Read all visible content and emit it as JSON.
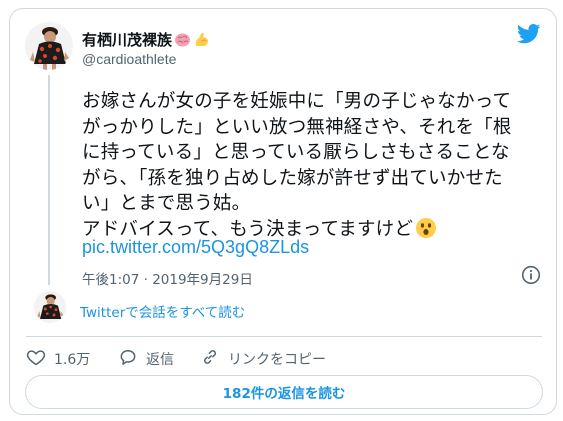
{
  "author": {
    "name": "有栖川茂裸族",
    "emojis": [
      "brain-emoji",
      "flexed-biceps-emoji"
    ],
    "handle": "@cardioathlete"
  },
  "tweet": {
    "lines": [
      "お嫁さんが女の子を妊娠中に「男の子じゃなかって",
      "がっかりした」といい放つ無神経さや、それを「根",
      "に持っている」と思っている厭らしさもさることな",
      "がら、「孫を独り占めした嫁が許せず出ていかせた",
      "い」とまで思う姑。",
      "アドバイスって、もう決まってますけど"
    ],
    "trailing_emoji": "astonished-face-emoji",
    "link": "pic.twitter.com/5Q3gQ8ZLds",
    "timestamp": "午後1:07 · 2019年9月29日"
  },
  "conversation_link": "Twitterで会話をすべて読む",
  "actions": {
    "like_count": "1.6万",
    "reply_label": "返信",
    "copy_link_label": "リンクをコピー"
  },
  "replies_button": "182件の返信を読む",
  "colors": {
    "accent": "#1b95e0",
    "twitter_blue": "#1da1f2",
    "muted": "#536471",
    "border": "#cfd9de"
  },
  "icons": [
    "twitter-bird-icon",
    "info-icon",
    "heart-icon",
    "reply-bubble-icon",
    "link-icon"
  ]
}
